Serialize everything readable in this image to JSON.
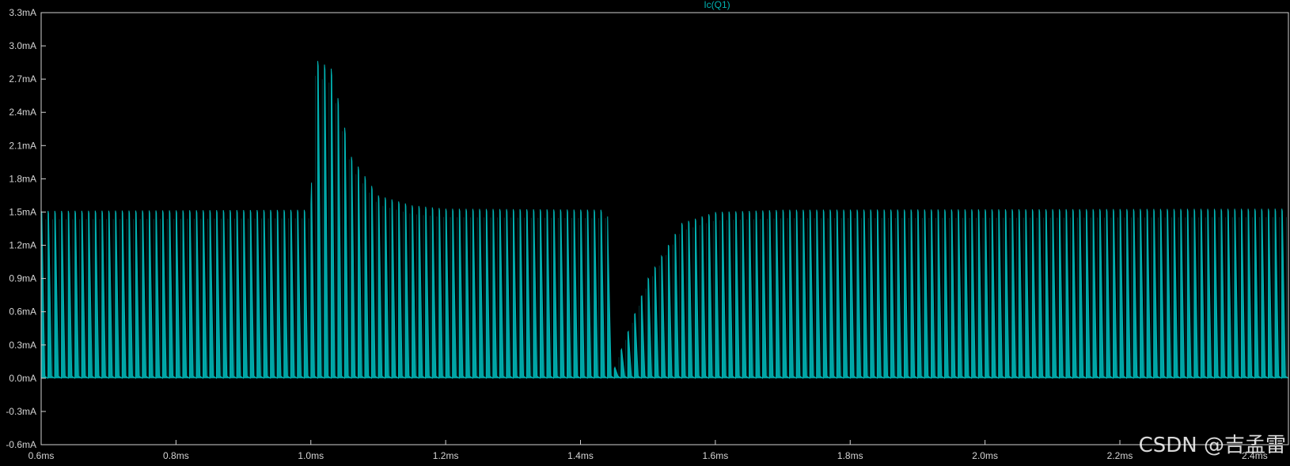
{
  "chart_data": {
    "type": "line",
    "title": "Ic(Q1)",
    "xlabel": "",
    "ylabel": "",
    "xlim": [
      0.6,
      2.45
    ],
    "ylim": [
      -0.6,
      3.3
    ],
    "x_unit": "ms",
    "y_unit": "mA",
    "grid": false,
    "x_ticks": [
      "0.6ms",
      "0.8ms",
      "1.0ms",
      "1.2ms",
      "1.4ms",
      "1.6ms",
      "1.8ms",
      "2.0ms",
      "2.2ms",
      "2.4ms"
    ],
    "x_tick_values": [
      0.6,
      0.8,
      1.0,
      1.2,
      1.4,
      1.6,
      1.8,
      2.0,
      2.2,
      2.4
    ],
    "y_ticks": [
      "3.3mA",
      "3.0mA",
      "2.7mA",
      "2.4mA",
      "2.1mA",
      "1.8mA",
      "1.5mA",
      "1.2mA",
      "0.9mA",
      "0.6mA",
      "0.3mA",
      "0.0mA",
      "-0.3mA",
      "-0.6mA"
    ],
    "y_tick_values": [
      3.3,
      3.0,
      2.7,
      2.4,
      2.1,
      1.8,
      1.5,
      1.2,
      0.9,
      0.6,
      0.3,
      0.0,
      -0.3,
      -0.6
    ],
    "series": [
      {
        "name": "Ic(Q1)",
        "color": "#00b3b3",
        "description_points": {
          "x": [
            0.6,
            1.0,
            1.005,
            1.03,
            1.06,
            1.1,
            1.15,
            1.2,
            1.44,
            1.445,
            1.46,
            1.5,
            1.55,
            1.6,
            1.7,
            2.45
          ],
          "peak": [
            1.51,
            1.52,
            2.88,
            2.8,
            2.0,
            1.65,
            1.56,
            1.53,
            1.52,
            0.0,
            0.25,
            0.9,
            1.4,
            1.5,
            1.52,
            1.53
          ],
          "trough": [
            0.0,
            0.0,
            0.0,
            0.0,
            0.0,
            0.0,
            0.0,
            0.0,
            0.0,
            0.0,
            0.0,
            0.0,
            0.0,
            0.0,
            0.0,
            0.0
          ]
        },
        "switching_period_ms": 0.01
      }
    ]
  },
  "watermark": "CSDN @吉孟雷"
}
